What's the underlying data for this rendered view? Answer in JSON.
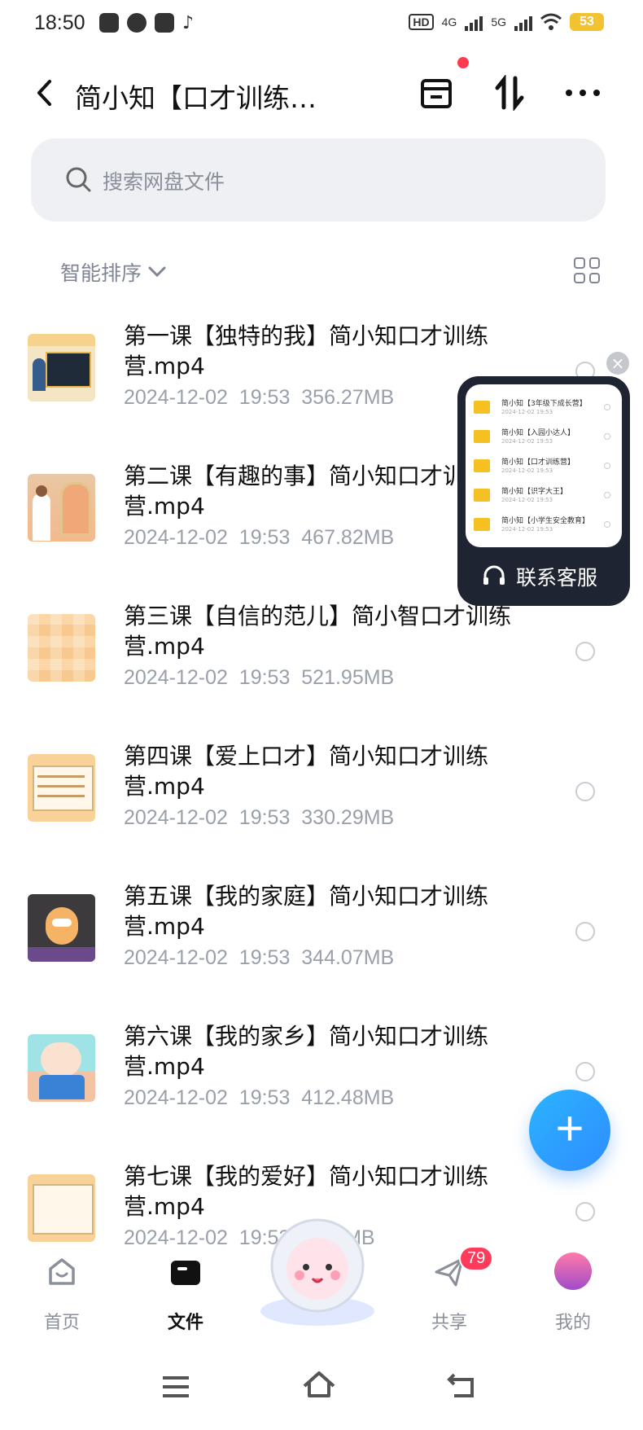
{
  "status_bar": {
    "time": "18:50",
    "network_1": "4G",
    "network_2": "5G",
    "battery": "53"
  },
  "header": {
    "title": "简小知【口才训练…",
    "back_icon": "chevron-left-icon",
    "actions": [
      "transfer-list-icon",
      "sort-arrows-icon",
      "more-icon"
    ]
  },
  "search": {
    "placeholder": "搜索网盘文件"
  },
  "sort": {
    "label": "智能排序"
  },
  "files": [
    {
      "name": "第一课【独特的我】简小知口才训练营.mp4",
      "date": "2024-12-02",
      "time": "19:53",
      "size": "356.27MB"
    },
    {
      "name": "第二课【有趣的事】简小知口才训练营.mp4",
      "date": "2024-12-02",
      "time": "19:53",
      "size": "467.82MB"
    },
    {
      "name": "第三课【自信的范儿】简小智口才训练营.mp4",
      "date": "2024-12-02",
      "time": "19:53",
      "size": "521.95MB"
    },
    {
      "name": "第四课【爱上口才】简小知口才训练营.mp4",
      "date": "2024-12-02",
      "time": "19:53",
      "size": "330.29MB"
    },
    {
      "name": "第五课【我的家庭】简小知口才训练营.mp4",
      "date": "2024-12-02",
      "time": "19:53",
      "size": "344.07MB"
    },
    {
      "name": "第六课【我的家乡】简小知口才训练营.mp4",
      "date": "2024-12-02",
      "time": "19:53",
      "size": "412.48MB"
    },
    {
      "name": "第七课【我的爱好】简小知口才训练营.mp4",
      "date": "2024-12-02",
      "time": "19:53",
      "size": "…73MB"
    }
  ],
  "customer_service": {
    "label": "联系客服",
    "preview_rows": [
      {
        "title": "简小知【3年级下成长营】",
        "sub": "2024-12-02 19:53"
      },
      {
        "title": "简小知【入园小达人】",
        "sub": "2024-12-02 19:53"
      },
      {
        "title": "简小知【口才训练营】",
        "sub": "2024-12-02 19:53"
      },
      {
        "title": "简小知【识字大王】",
        "sub": "2024-12-02 19:53"
      },
      {
        "title": "简小知【小学生安全教育】",
        "sub": "2024-12-02 19:53"
      }
    ]
  },
  "tabs": [
    {
      "label": "首页"
    },
    {
      "label": "文件"
    },
    {
      "label": "共享",
      "badge": "79"
    },
    {
      "label": "我的"
    }
  ],
  "colors": {
    "accent": "#2f8cff",
    "badge": "#ff3b5c",
    "folder": "#f5c022"
  }
}
